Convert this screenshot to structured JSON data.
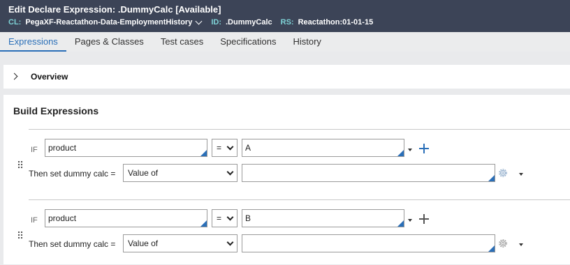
{
  "header": {
    "edit_label": "Edit",
    "rule_type": "Declare Expression:",
    "rule_name": ".DummyCalc",
    "status": "[Available]",
    "cl_key": "CL:",
    "cl_value": "PegaXF-Reactathon-Data-EmploymentHistory",
    "id_key": "ID:",
    "id_value": ".DummyCalc",
    "rs_key": "RS:",
    "rs_value": "Reactathon:01-01-15"
  },
  "tabs": [
    {
      "label": "Expressions",
      "active": true
    },
    {
      "label": "Pages & Classes",
      "active": false
    },
    {
      "label": "Test cases",
      "active": false
    },
    {
      "label": "Specifications",
      "active": false
    },
    {
      "label": "History",
      "active": false
    }
  ],
  "overview": {
    "label": "Overview"
  },
  "build": {
    "title": "Build Expressions",
    "rows": [
      {
        "if_label": "IF",
        "property": "product",
        "operator": "=",
        "value": "A",
        "then_label": "Then set dummy calc =",
        "mode": "Value of",
        "expression": "",
        "plus_color": "#2a6fb8"
      },
      {
        "if_label": "IF",
        "property": "product",
        "operator": "=",
        "value": "B",
        "then_label": "Then set dummy calc =",
        "mode": "Value of",
        "expression": "",
        "plus_color": "#555555"
      }
    ]
  },
  "colors": {
    "header_bg": "#3c4457",
    "accent": "#2a6fb8",
    "meta_key": "#7fd3d7"
  }
}
